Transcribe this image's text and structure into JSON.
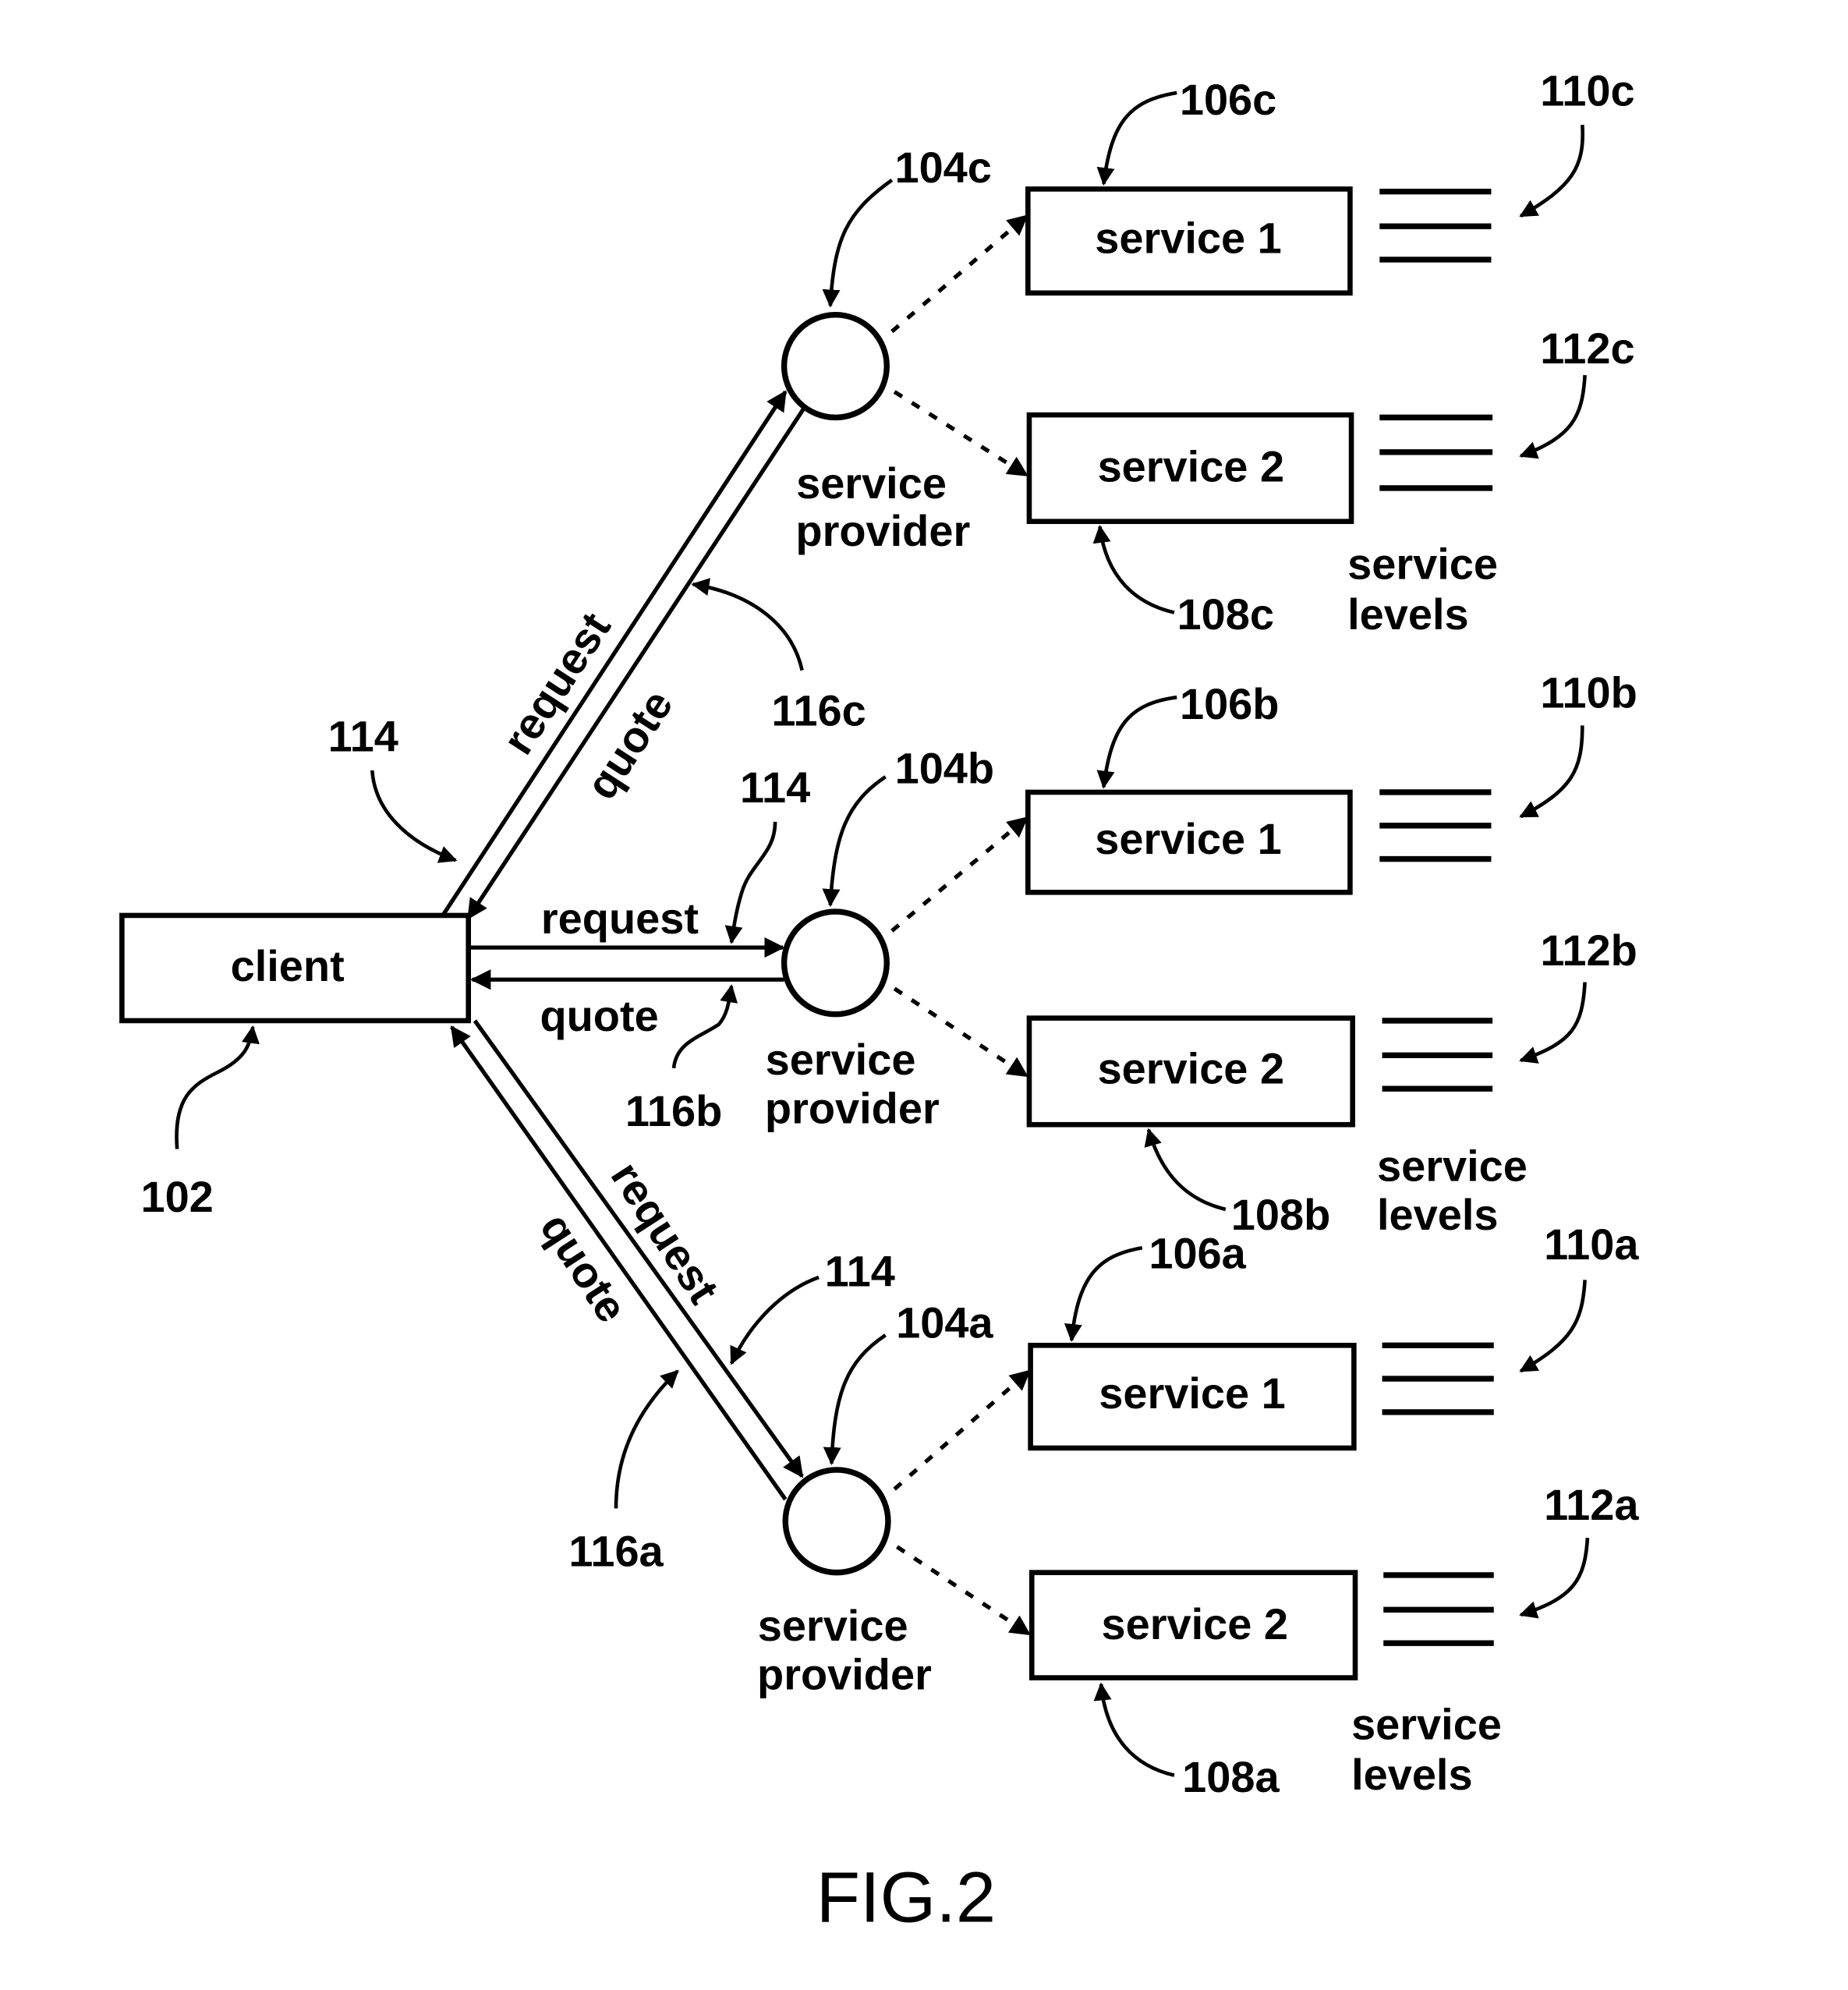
{
  "figure": {
    "caption": "FIG.2"
  },
  "client": {
    "label": "client",
    "ref": "102"
  },
  "links": {
    "request_label": "request",
    "quote_label": "quote",
    "request_ref": "114",
    "quote_refs": {
      "a": "116a",
      "b": "116b",
      "c": "116c"
    }
  },
  "providers": [
    {
      "id": "c",
      "ref": "104c",
      "label_line1": "service",
      "label_line2": "provider"
    },
    {
      "id": "b",
      "ref": "104b",
      "label_line1": "service",
      "label_line2": "provider"
    },
    {
      "id": "a",
      "ref": "104a",
      "label_line1": "service",
      "label_line2": "provider"
    }
  ],
  "services": {
    "c": [
      {
        "label": "service 1",
        "ref": "106c",
        "levels_ref": "110c"
      },
      {
        "label": "service 2",
        "ref": "108c",
        "levels_ref": "112c"
      }
    ],
    "b": [
      {
        "label": "service 1",
        "ref": "106b",
        "levels_ref": "110b"
      },
      {
        "label": "service 2",
        "ref": "108b",
        "levels_ref": "112b"
      }
    ],
    "a": [
      {
        "label": "service 1",
        "ref": "106a",
        "levels_ref": "110a"
      },
      {
        "label": "service 2",
        "ref": "108a",
        "levels_ref": "112a"
      }
    ]
  },
  "service_levels_label": {
    "line1": "service",
    "line2": "levels"
  }
}
